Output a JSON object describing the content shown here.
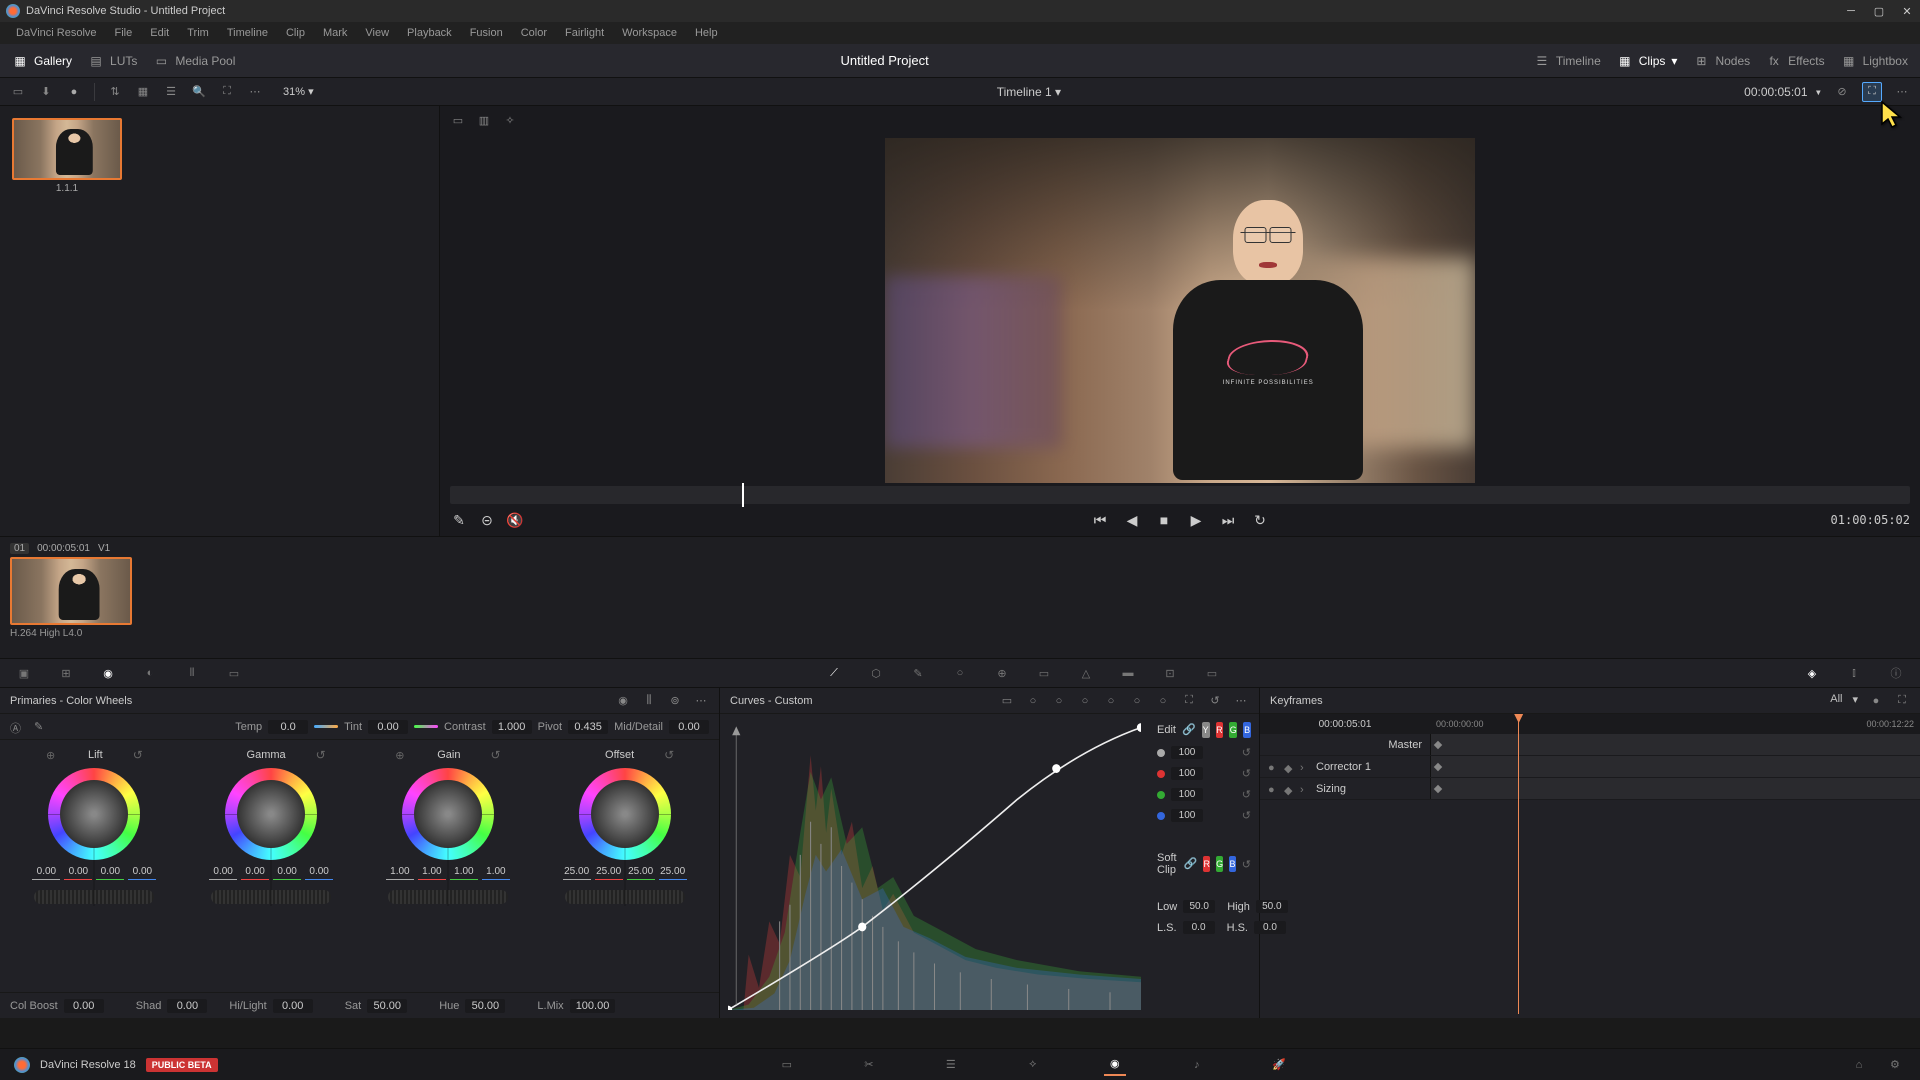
{
  "titlebar": {
    "app": "DaVinci Resolve Studio",
    "project": "Untitled Project"
  },
  "menu": [
    "DaVinci Resolve",
    "File",
    "Edit",
    "Trim",
    "Timeline",
    "Clip",
    "Mark",
    "View",
    "Playback",
    "Fusion",
    "Color",
    "Fairlight",
    "Workspace",
    "Help"
  ],
  "toolbar": {
    "gallery": "Gallery",
    "luts": "LUTs",
    "mediapool": "Media Pool",
    "project_title": "Untitled Project",
    "timeline": "Timeline",
    "clips": "Clips",
    "nodes": "Nodes",
    "effects": "Effects",
    "lightbox": "Lightbox"
  },
  "subtoolbar": {
    "zoom": "31%",
    "timeline_name": "Timeline 1",
    "timecode": "00:00:05:01"
  },
  "gallery": {
    "thumb_label": "1.1.1"
  },
  "transport": {
    "timecode_out": "01:00:05:02"
  },
  "clips": {
    "num": "01",
    "tc": "00:00:05:01",
    "track": "V1",
    "codec": "H.264 High L4.0"
  },
  "primaries": {
    "title": "Primaries - Color Wheels",
    "params": {
      "temp": {
        "label": "Temp",
        "val": "0.0"
      },
      "tint": {
        "label": "Tint",
        "val": "0.00"
      },
      "contrast": {
        "label": "Contrast",
        "val": "1.000"
      },
      "pivot": {
        "label": "Pivot",
        "val": "0.435"
      },
      "middetail": {
        "label": "Mid/Detail",
        "val": "0.00"
      }
    },
    "wheels": {
      "lift": {
        "label": "Lift",
        "vals": [
          "0.00",
          "0.00",
          "0.00",
          "0.00"
        ]
      },
      "gamma": {
        "label": "Gamma",
        "vals": [
          "0.00",
          "0.00",
          "0.00",
          "0.00"
        ]
      },
      "gain": {
        "label": "Gain",
        "vals": [
          "1.00",
          "1.00",
          "1.00",
          "1.00"
        ]
      },
      "offset": {
        "label": "Offset",
        "vals": [
          "25.00",
          "25.00",
          "25.00",
          "25.00"
        ]
      }
    },
    "bottom": {
      "colboost": {
        "label": "Col Boost",
        "val": "0.00"
      },
      "shad": {
        "label": "Shad",
        "val": "0.00"
      },
      "hilight": {
        "label": "Hi/Light",
        "val": "0.00"
      },
      "sat": {
        "label": "Sat",
        "val": "50.00"
      },
      "hue": {
        "label": "Hue",
        "val": "50.00"
      },
      "lmix": {
        "label": "L.Mix",
        "val": "100.00"
      }
    }
  },
  "curves": {
    "title": "Curves - Custom",
    "edit_label": "Edit",
    "softclip_label": "Soft Clip",
    "channels": {
      "y": "Y",
      "r": "R",
      "g": "G",
      "b": "B"
    },
    "vals": {
      "y": "100",
      "r": "100",
      "g": "100",
      "b": "100"
    },
    "low": {
      "label": "Low",
      "val": "50.0"
    },
    "high": {
      "label": "High",
      "val": "50.0"
    },
    "ls": {
      "label": "L.S.",
      "val": "0.0"
    },
    "hs": {
      "label": "H.S.",
      "val": "0.0"
    }
  },
  "keyframes": {
    "title": "Keyframes",
    "all": "All",
    "tc": "00:00:05:01",
    "tc_start": "00:00:00:00",
    "tc_end": "00:00:12:22",
    "rows": {
      "master": "Master",
      "corrector": "Corrector 1",
      "sizing": "Sizing"
    }
  },
  "pagebar": {
    "name": "DaVinci Resolve 18",
    "badge": "PUBLIC BETA"
  }
}
